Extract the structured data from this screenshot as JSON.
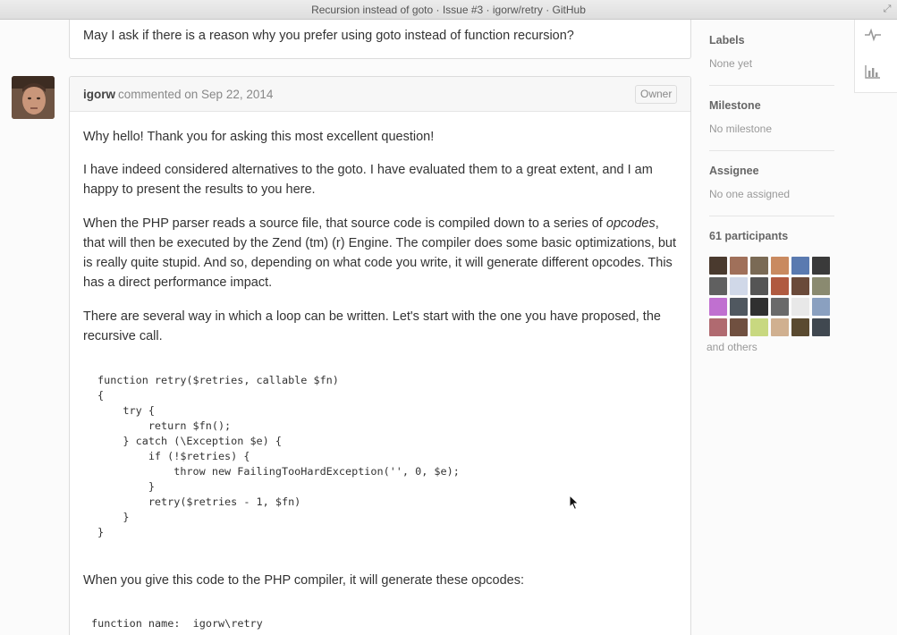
{
  "window": {
    "title": "Recursion instead of goto · Issue #3 · igorw/retry · GitHub"
  },
  "previous_comment": {
    "text": "May I ask if there is a reason why you prefer using goto instead of function recursion?"
  },
  "comment": {
    "author": "igorw",
    "meta": "commented on Sep 22, 2014",
    "badge": "Owner",
    "paragraphs": {
      "p1": "Why hello! Thank you for asking this most excellent question!",
      "p2": "I have indeed considered alternatives to the goto. I have evaluated them to a great extent, and I am happy to present the results to you here.",
      "p3a": "When the PHP parser reads a source file, that source code is compiled down to a series of ",
      "p3em": "opcodes",
      "p3b": ", that will then be executed by the Zend (tm) (r) Engine. The compiler does some basic optimizations, but is really quite stupid. And so, depending on what code you write, it will generate different opcodes. This has a direct performance impact.",
      "p4": "There are several way in which a loop can be written. Let's start with the one you have proposed, the recursive call.",
      "p5": "When you give this code to the PHP compiler, it will generate these opcodes:"
    },
    "code": "function retry($retries, callable $fn)\n{\n    try {\n        return $fn();\n    } catch (\\Exception $e) {\n        if (!$retries) {\n            throw new FailingTooHardException('', 0, $e);\n        }\n        retry($retries - 1, $fn)\n    }\n}",
    "opcode_header": "function name:  igorw\\retry"
  },
  "sidebar": {
    "labels": {
      "title": "Labels",
      "value": "None yet"
    },
    "milestone": {
      "title": "Milestone",
      "value": "No milestone"
    },
    "assignee": {
      "title": "Assignee",
      "value": "No one assigned"
    },
    "participants": {
      "title": "61 participants",
      "others": "and others"
    },
    "participant_colors": [
      "#4a3a2e",
      "#a0705a",
      "#7a6a55",
      "#c98a60",
      "#5a7ab0",
      "#3a3a3a",
      "#606060",
      "#d0d8e8",
      "#555555",
      "#b05a40",
      "#6a4a3a",
      "#8a8a70",
      "#c070d0",
      "#505860",
      "#303030",
      "#6a6a6a",
      "#e8e8e8",
      "#8aa0c0",
      "#b06a70",
      "#705040",
      "#c8d880",
      "#d0b090",
      "#5a4a30",
      "#404850"
    ]
  },
  "rail": {
    "icons": [
      "pulse-icon",
      "graph-icon"
    ]
  }
}
